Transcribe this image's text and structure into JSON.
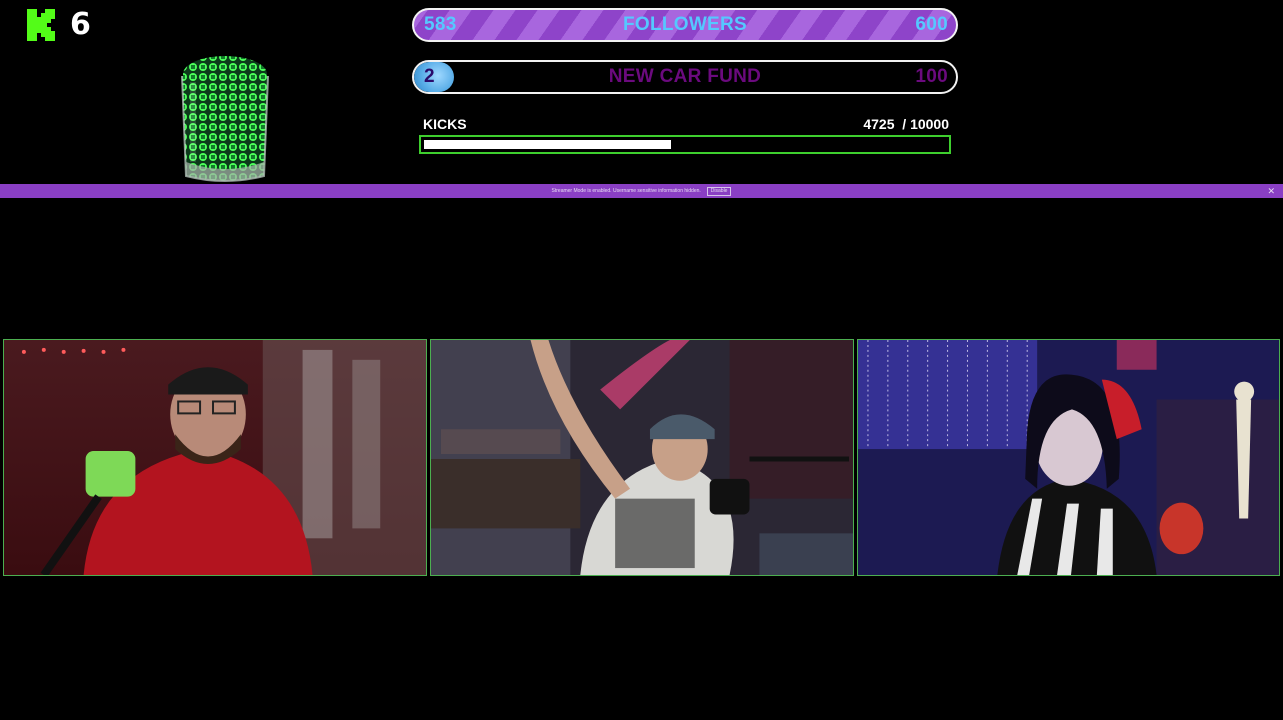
{
  "kick_badge": {
    "icon": "kick-logo-icon",
    "count": "6",
    "brand_color": "#53fc18"
  },
  "goals": {
    "followers": {
      "current": "583",
      "label": "FOLLOWERS",
      "target": "600",
      "progress": 0.97
    },
    "car_fund": {
      "current": "2",
      "label": "NEW CAR FUND",
      "target": "100",
      "progress": 0.02
    }
  },
  "kicks": {
    "label": "KICKS",
    "count_text": "4725  / 10000",
    "value": 4725,
    "max": 10000
  },
  "notice": {
    "text": "Streamer Mode is enabled. Username sensitive information hidden.",
    "button": "Disable"
  },
  "cameras": [
    {
      "name": "camera-left",
      "tint": "#5a0e14"
    },
    {
      "name": "camera-center",
      "tint": "#2c2838"
    },
    {
      "name": "camera-right",
      "tint": "#1c1a5a"
    }
  ]
}
